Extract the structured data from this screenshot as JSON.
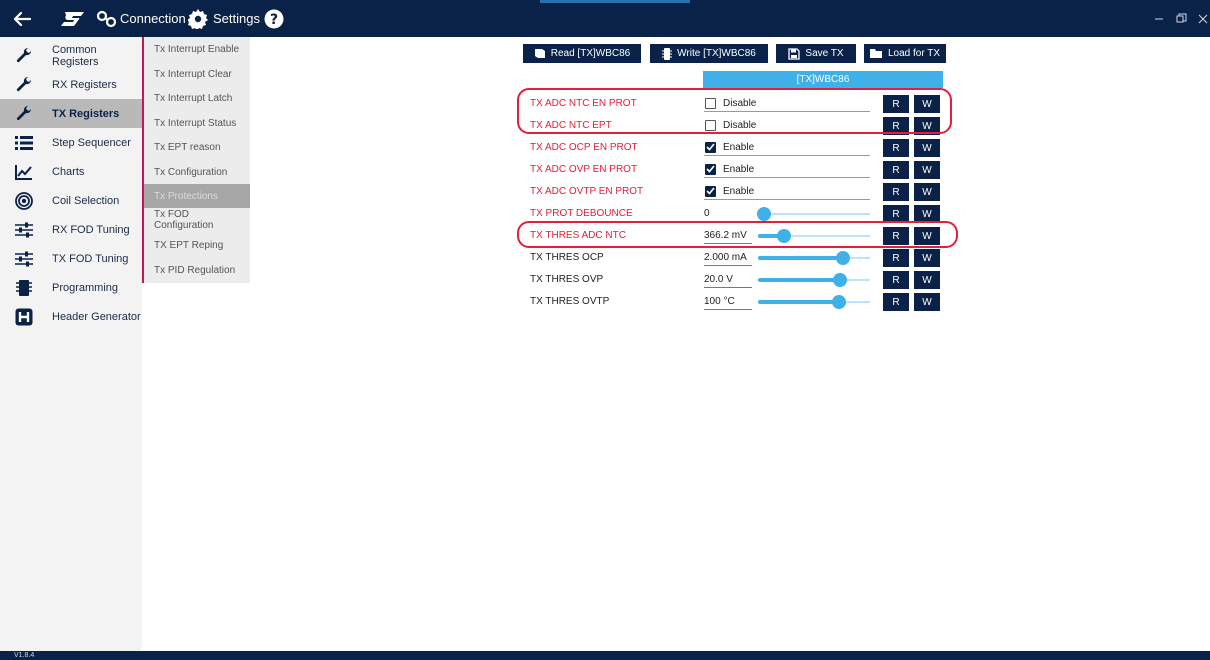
{
  "topbar": {
    "connection_label": "Connection",
    "settings_label": "Settings"
  },
  "sidebar": {
    "items": [
      {
        "label": "Common Registers",
        "icon": "wrench-icon"
      },
      {
        "label": "RX Registers",
        "icon": "wrench-icon"
      },
      {
        "label": "TX Registers",
        "icon": "wrench-icon",
        "active": true
      },
      {
        "label": "Step Sequencer",
        "icon": "list-icon"
      },
      {
        "label": "Charts",
        "icon": "chart-icon"
      },
      {
        "label": "Coil Selection",
        "icon": "target-icon"
      },
      {
        "label": "RX FOD Tuning",
        "icon": "sliders-icon"
      },
      {
        "label": "TX FOD Tuning",
        "icon": "sliders-icon"
      },
      {
        "label": "Programming",
        "icon": "chip-icon"
      },
      {
        "label": "Header Generator",
        "icon": "header-icon"
      }
    ]
  },
  "submenu": {
    "items": [
      {
        "label": "Tx Interrupt Enable"
      },
      {
        "label": "Tx Interrupt Clear"
      },
      {
        "label": "Tx Interrupt Latch"
      },
      {
        "label": "Tx Interrupt Status"
      },
      {
        "label": "Tx EPT reason"
      },
      {
        "label": "Tx Configuration"
      },
      {
        "label": "Tx Protections",
        "active": true
      },
      {
        "label": "Tx FOD Configuration"
      },
      {
        "label": "TX EPT Reping"
      },
      {
        "label": "Tx PID Regulation"
      }
    ]
  },
  "toolbar": {
    "read_label": "Read [TX]WBC86",
    "write_label": "Write [TX]WBC86",
    "save_label": "Save TX",
    "load_label": "Load for TX"
  },
  "chip_header": "[TX]WBC86",
  "registers": [
    {
      "label": "TX ADC NTC EN PROT",
      "kind": "checkbox",
      "checked": false,
      "value": "Disable",
      "color": "red"
    },
    {
      "label": "TX ADC NTC EPT",
      "kind": "checkbox",
      "checked": false,
      "value": "Disable",
      "color": "red"
    },
    {
      "label": "TX ADC OCP EN PROT",
      "kind": "checkbox",
      "checked": true,
      "value": "Enable",
      "color": "red"
    },
    {
      "label": "TX ADC OVP EN PROT",
      "kind": "checkbox",
      "checked": true,
      "value": "Enable",
      "color": "red"
    },
    {
      "label": "TX ADC OVTP EN PROT",
      "kind": "checkbox",
      "checked": true,
      "value": "Enable",
      "color": "red"
    },
    {
      "label": "TX PROT DEBOUNCE",
      "kind": "slider",
      "value": "0",
      "level": 0.05,
      "color": "red"
    },
    {
      "label": "TX THRES ADC NTC",
      "kind": "slider",
      "value": "366.2 mV",
      "level": 0.23,
      "color": "red"
    },
    {
      "label": "TX THRES OCP",
      "kind": "slider",
      "value": "2.000 mA",
      "level": 0.76,
      "color": "dark"
    },
    {
      "label": "TX THRES OVP",
      "kind": "slider",
      "value": "20.0 V",
      "level": 0.73,
      "color": "dark"
    },
    {
      "label": "TX THRES OVTP",
      "kind": "slider",
      "value": "100 °C",
      "level": 0.72,
      "color": "dark"
    }
  ],
  "rw": {
    "read": "R",
    "write": "W"
  },
  "status": {
    "version": "V1.8.4"
  },
  "colors": {
    "nav": "#0b2248",
    "accent": "#3fb0e8",
    "alert": "#e0203c"
  }
}
